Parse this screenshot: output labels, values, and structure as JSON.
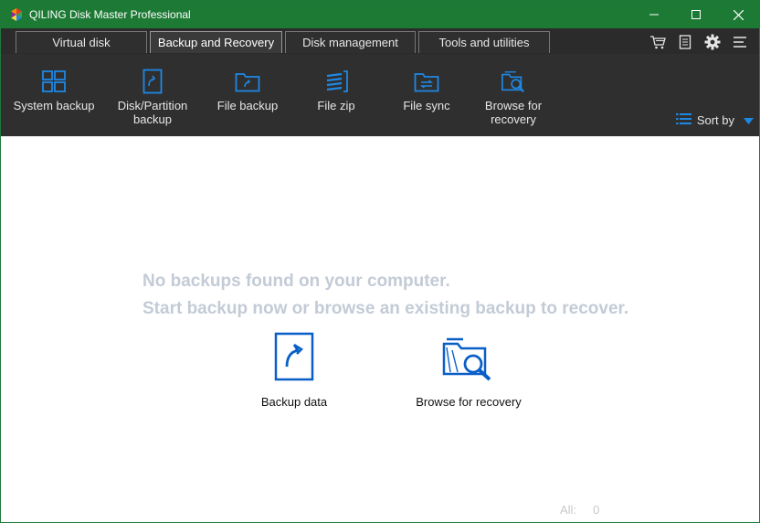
{
  "window": {
    "title": "QILING Disk Master Professional",
    "controls": {
      "minimize": "—",
      "maximize": "☐",
      "close": "✕"
    }
  },
  "tabs": [
    {
      "label": "Virtual disk",
      "active": false
    },
    {
      "label": "Backup and Recovery",
      "active": true
    },
    {
      "label": "Disk management",
      "active": false
    },
    {
      "label": "Tools and utilities",
      "active": false
    }
  ],
  "top_tools": [
    "cart-icon",
    "document-icon",
    "gear-icon",
    "menu-icon"
  ],
  "toolbar": {
    "items": [
      {
        "label": "System backup",
        "icon": "windows-icon"
      },
      {
        "label": "Disk/Partition\nbackup",
        "icon": "disk-backup-icon"
      },
      {
        "label": "File backup",
        "icon": "folder-icon"
      },
      {
        "label": "File zip",
        "icon": "zip-icon"
      },
      {
        "label": "File sync",
        "icon": "sync-folder-icon"
      },
      {
        "label": "Browse for\nrecovery",
        "icon": "folder-search-icon"
      }
    ],
    "sort_label": "Sort by"
  },
  "content": {
    "empty_line1": "No backups found on your computer.",
    "empty_line2": "Start backup now or browse an existing backup to recover.",
    "actions": [
      {
        "label": "Backup data",
        "icon": "backup-data-icon"
      },
      {
        "label": "Browse for recovery",
        "icon": "browse-recovery-icon"
      }
    ],
    "footer": {
      "all_label": "All:",
      "count": "0"
    }
  },
  "colors": {
    "titlebar": "#1d7a35",
    "ribbon": "#2f2f2f",
    "accent_blue": "#1e88e5",
    "icon_blue": "#0a5fc7",
    "empty_text": "#c3cbd6"
  }
}
